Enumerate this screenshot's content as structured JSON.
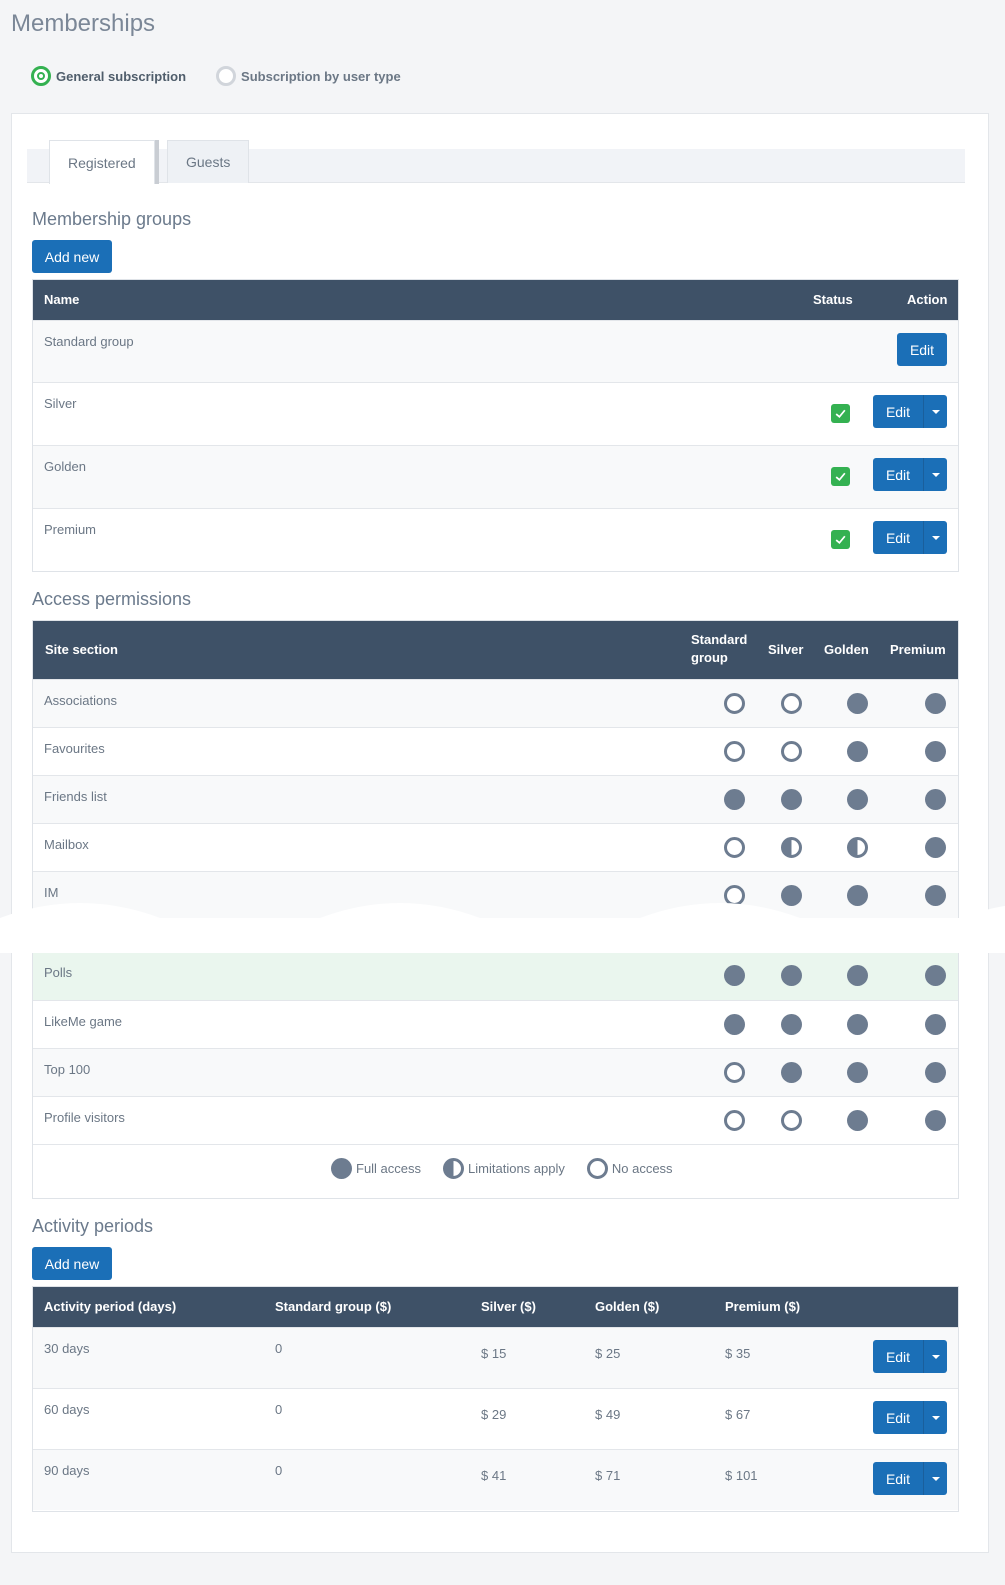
{
  "page": {
    "title": "Memberships"
  },
  "subscription_mode": {
    "options": [
      {
        "label": "General subscription",
        "selected": true
      },
      {
        "label": "Subscription by user type",
        "selected": false
      }
    ]
  },
  "tabs": [
    {
      "label": "Registered",
      "active": true
    },
    {
      "label": "Guests",
      "active": false
    }
  ],
  "membership_groups": {
    "title": "Membership groups",
    "add_label": "Add new",
    "columns": {
      "name": "Name",
      "status": "Status",
      "action": "Action"
    },
    "rows": [
      {
        "name": "Standard group",
        "status": null,
        "action": "Edit",
        "dropdown": false
      },
      {
        "name": "Silver",
        "status": "active",
        "action": "Edit",
        "dropdown": true
      },
      {
        "name": "Golden",
        "status": "active",
        "action": "Edit",
        "dropdown": true
      },
      {
        "name": "Premium",
        "status": "active",
        "action": "Edit",
        "dropdown": true
      }
    ]
  },
  "access_permissions": {
    "title": "Access permissions",
    "columns": {
      "section": "Site section",
      "standard_line1": "Standard",
      "standard_line2": "group",
      "silver": "Silver",
      "golden": "Golden",
      "premium": "Premium"
    },
    "rows_top": [
      {
        "section": "Associations",
        "levels": [
          "none",
          "none",
          "full",
          "full"
        ]
      },
      {
        "section": "Favourites",
        "levels": [
          "none",
          "none",
          "full",
          "full"
        ]
      },
      {
        "section": "Friends list",
        "levels": [
          "full",
          "full",
          "full",
          "full"
        ]
      },
      {
        "section": "Mailbox",
        "levels": [
          "none",
          "limit",
          "limit",
          "full"
        ]
      },
      {
        "section": "IM",
        "levels": [
          "none",
          "full",
          "full",
          "full"
        ]
      }
    ],
    "rows_bottom": [
      {
        "section": "Polls",
        "levels": [
          "full",
          "full",
          "full",
          "full"
        ]
      },
      {
        "section": "LikeMe game",
        "levels": [
          "full",
          "full",
          "full",
          "full"
        ]
      },
      {
        "section": "Top 100",
        "levels": [
          "none",
          "full",
          "full",
          "full"
        ]
      },
      {
        "section": "Profile visitors",
        "levels": [
          "none",
          "none",
          "full",
          "full"
        ]
      }
    ],
    "legend": {
      "full": "Full access",
      "limit": "Limitations apply",
      "none": "No access"
    }
  },
  "activity_periods": {
    "title": "Activity periods",
    "add_label": "Add new",
    "columns": {
      "period": "Activity period (days)",
      "standard": "Standard group ($)",
      "silver": "Silver ($)",
      "golden": "Golden ($)",
      "premium": "Premium ($)"
    },
    "rows": [
      {
        "period": "30 days",
        "standard": "0",
        "silver": "$ 15",
        "golden": "$ 25",
        "premium": "$ 35",
        "action": "Edit"
      },
      {
        "period": "60 days",
        "standard": "0",
        "silver": "$ 29",
        "golden": "$ 49",
        "premium": "$ 67",
        "action": "Edit"
      },
      {
        "period": "90 days",
        "standard": "0",
        "silver": "$ 41",
        "golden": "$ 71",
        "premium": "$ 101",
        "action": "Edit"
      }
    ]
  },
  "colors": {
    "header_bg": "#3e5167",
    "primary_button": "#1b6fb7",
    "status_green": "#34b151",
    "permission_icon": "#6d7c90"
  }
}
